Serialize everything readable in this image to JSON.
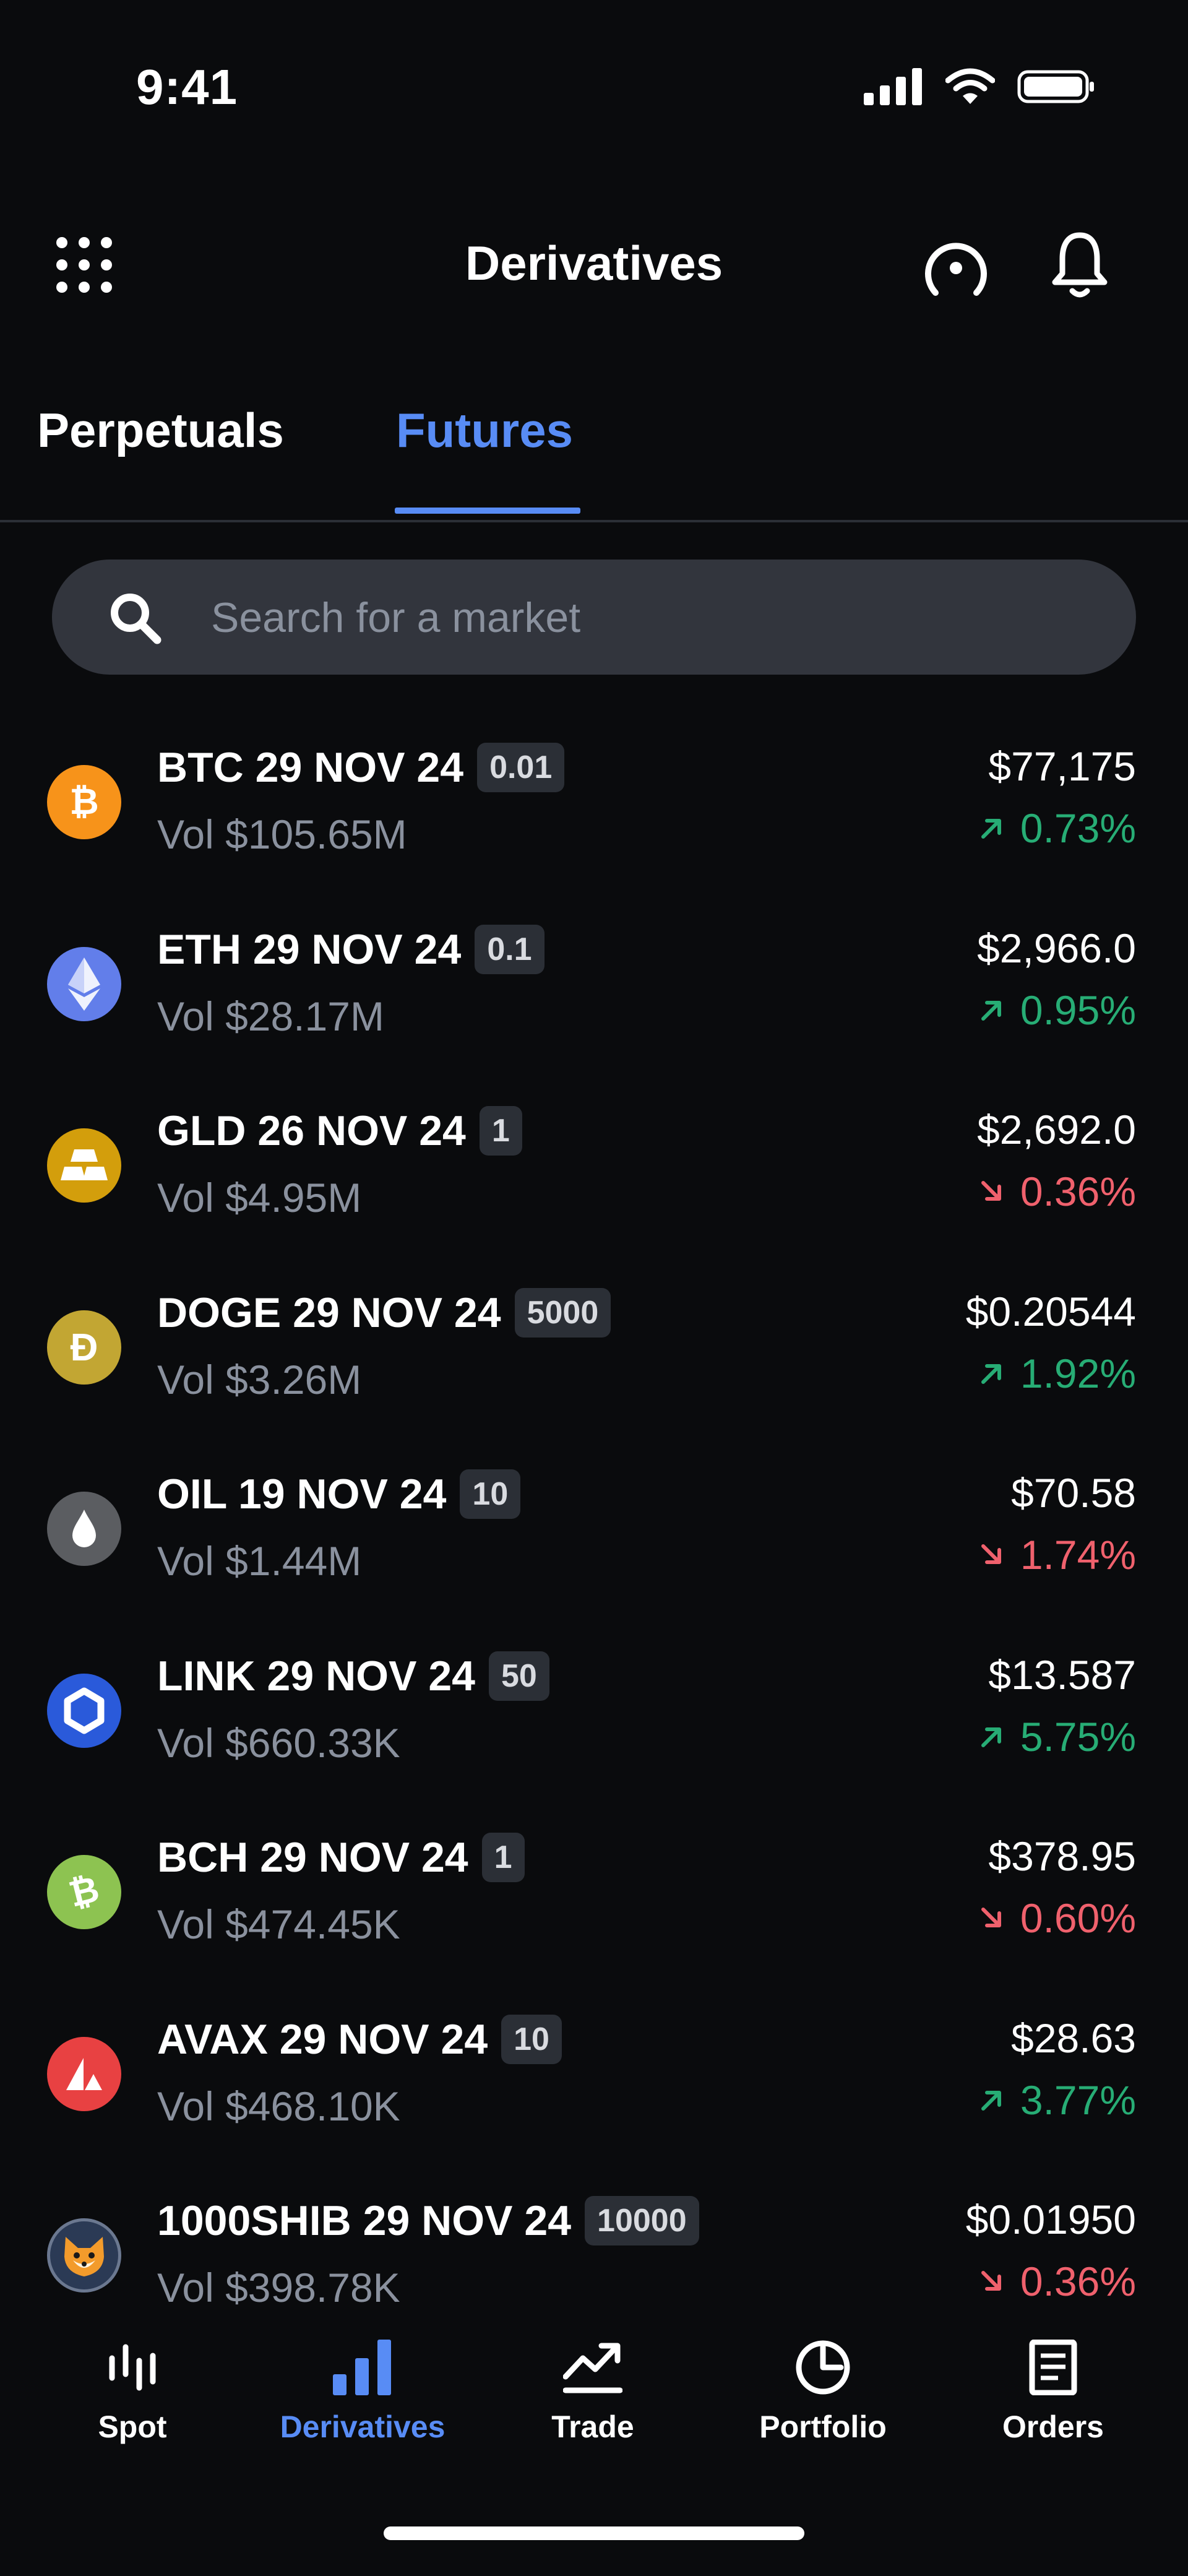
{
  "status_bar": {
    "time": "9:41"
  },
  "header": {
    "title": "Derivatives"
  },
  "tabs": [
    {
      "label": "Perpetuals",
      "active": false
    },
    {
      "label": "Futures",
      "active": true
    }
  ],
  "search": {
    "placeholder": "Search for a market"
  },
  "markets": [
    {
      "name": "BTC 29 NOV 24",
      "badge": "0.01",
      "volume": "Vol $105.65M",
      "price": "$77,175",
      "change": "0.73%",
      "direction": "up",
      "icon": "bitcoin-icon",
      "color": "#f7931a"
    },
    {
      "name": "ETH 29 NOV 24",
      "badge": "0.1",
      "volume": "Vol $28.17M",
      "price": "$2,966.0",
      "change": "0.95%",
      "direction": "up",
      "icon": "ethereum-icon",
      "color": "#627eea"
    },
    {
      "name": "GLD 26 NOV 24",
      "badge": "1",
      "volume": "Vol $4.95M",
      "price": "$2,692.0",
      "change": "0.36%",
      "direction": "down",
      "icon": "gold-bars-icon",
      "color": "#d39e0c"
    },
    {
      "name": "DOGE 29 NOV 24",
      "badge": "5000",
      "volume": "Vol $3.26M",
      "price": "$0.20544",
      "change": "1.92%",
      "direction": "up",
      "icon": "dogecoin-icon",
      "color": "#c2a633"
    },
    {
      "name": "OIL 19 NOV 24",
      "badge": "10",
      "volume": "Vol $1.44M",
      "price": "$70.58",
      "change": "1.74%",
      "direction": "down",
      "icon": "oil-drop-icon",
      "color": "#5b5d61"
    },
    {
      "name": "LINK 29 NOV 24",
      "badge": "50",
      "volume": "Vol $660.33K",
      "price": "$13.587",
      "change": "5.75%",
      "direction": "up",
      "icon": "chainlink-icon",
      "color": "#2a5ada"
    },
    {
      "name": "BCH 29 NOV 24",
      "badge": "1",
      "volume": "Vol $474.45K",
      "price": "$378.95",
      "change": "0.60%",
      "direction": "down",
      "icon": "bitcoin-cash-icon",
      "color": "#8dc351"
    },
    {
      "name": "AVAX 29 NOV 24",
      "badge": "10",
      "volume": "Vol $468.10K",
      "price": "$28.63",
      "change": "3.77%",
      "direction": "up",
      "icon": "avalanche-icon",
      "color": "#e84142"
    },
    {
      "name": "1000SHIB 29 NOV 24",
      "badge": "10000",
      "volume": "Vol $398.78K",
      "price": "$0.01950",
      "change": "0.36%",
      "direction": "down",
      "icon": "shiba-inu-icon",
      "color": "#2b3a55"
    }
  ],
  "bottom_nav": [
    {
      "label": "Spot",
      "icon": "spot-chart-icon",
      "active": false
    },
    {
      "label": "Derivatives",
      "icon": "bar-chart-icon",
      "active": true
    },
    {
      "label": "Trade",
      "icon": "trend-chart-icon",
      "active": false
    },
    {
      "label": "Portfolio",
      "icon": "pie-chart-icon",
      "active": false
    },
    {
      "label": "Orders",
      "icon": "document-icon",
      "active": false
    }
  ],
  "colors": {
    "background": "#0a0b0d",
    "accent": "#588cf5",
    "up": "#27ad75",
    "down": "#f0616d",
    "muted": "#8a919e"
  }
}
